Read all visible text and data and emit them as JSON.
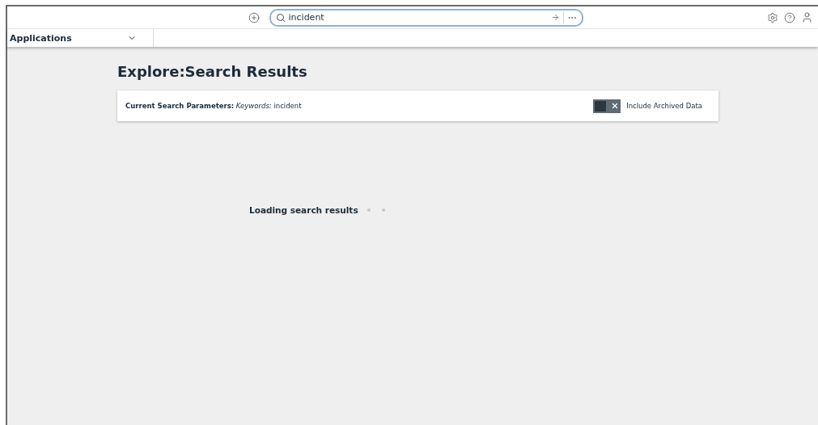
{
  "search": {
    "value": "incident"
  },
  "nav": {
    "label": "Applications"
  },
  "title": "Explore:Search Results",
  "parameters": {
    "text": "**Current Search Parameters:** *Keywords:* incident"
  },
  "archived_toggle": {
    "label": "Include Archived Data",
    "on": false
  },
  "loading": {
    "text": "Loading search results"
  }
}
